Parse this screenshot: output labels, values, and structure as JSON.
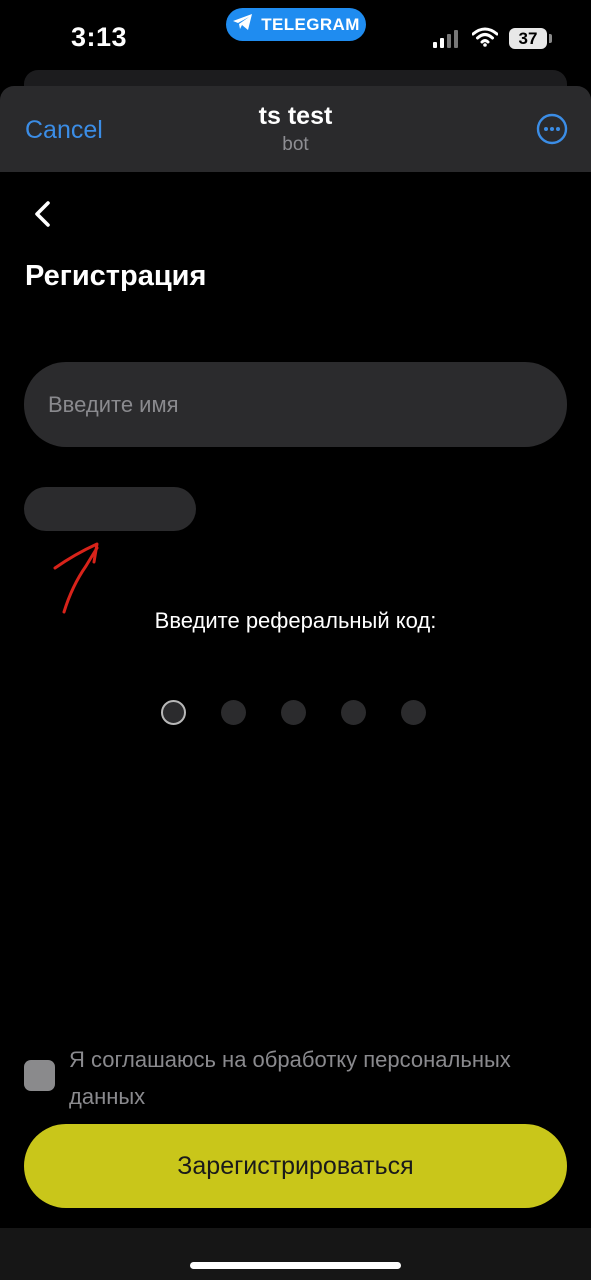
{
  "status_bar": {
    "time": "3:13",
    "app_badge": "TELEGRAM",
    "battery": "37",
    "icons": [
      "telegram-icon",
      "signal-icon",
      "wifi-icon",
      "battery-icon"
    ]
  },
  "header": {
    "cancel_label": "Cancel",
    "title": "ts test",
    "subtitle": "bot",
    "more_icon": "more-horizontal-icon"
  },
  "page": {
    "back_icon": "chevron-left-icon",
    "title": "Регистрация",
    "name_placeholder": "Введите имя",
    "referral_label": "Введите реферальный код:",
    "code_length": 5,
    "code_filled": 0
  },
  "consent": {
    "label": "Я соглашаюсь на обработку персональных данных",
    "checked": false
  },
  "submit_label": "Зарегистрироваться",
  "colors": {
    "accent_blue": "#3b8de6",
    "telegram_blue": "#1f8cf0",
    "submit_yellow": "#c9c61a",
    "surface": "#2b2b2d",
    "annotation_red": "#d8231a"
  }
}
